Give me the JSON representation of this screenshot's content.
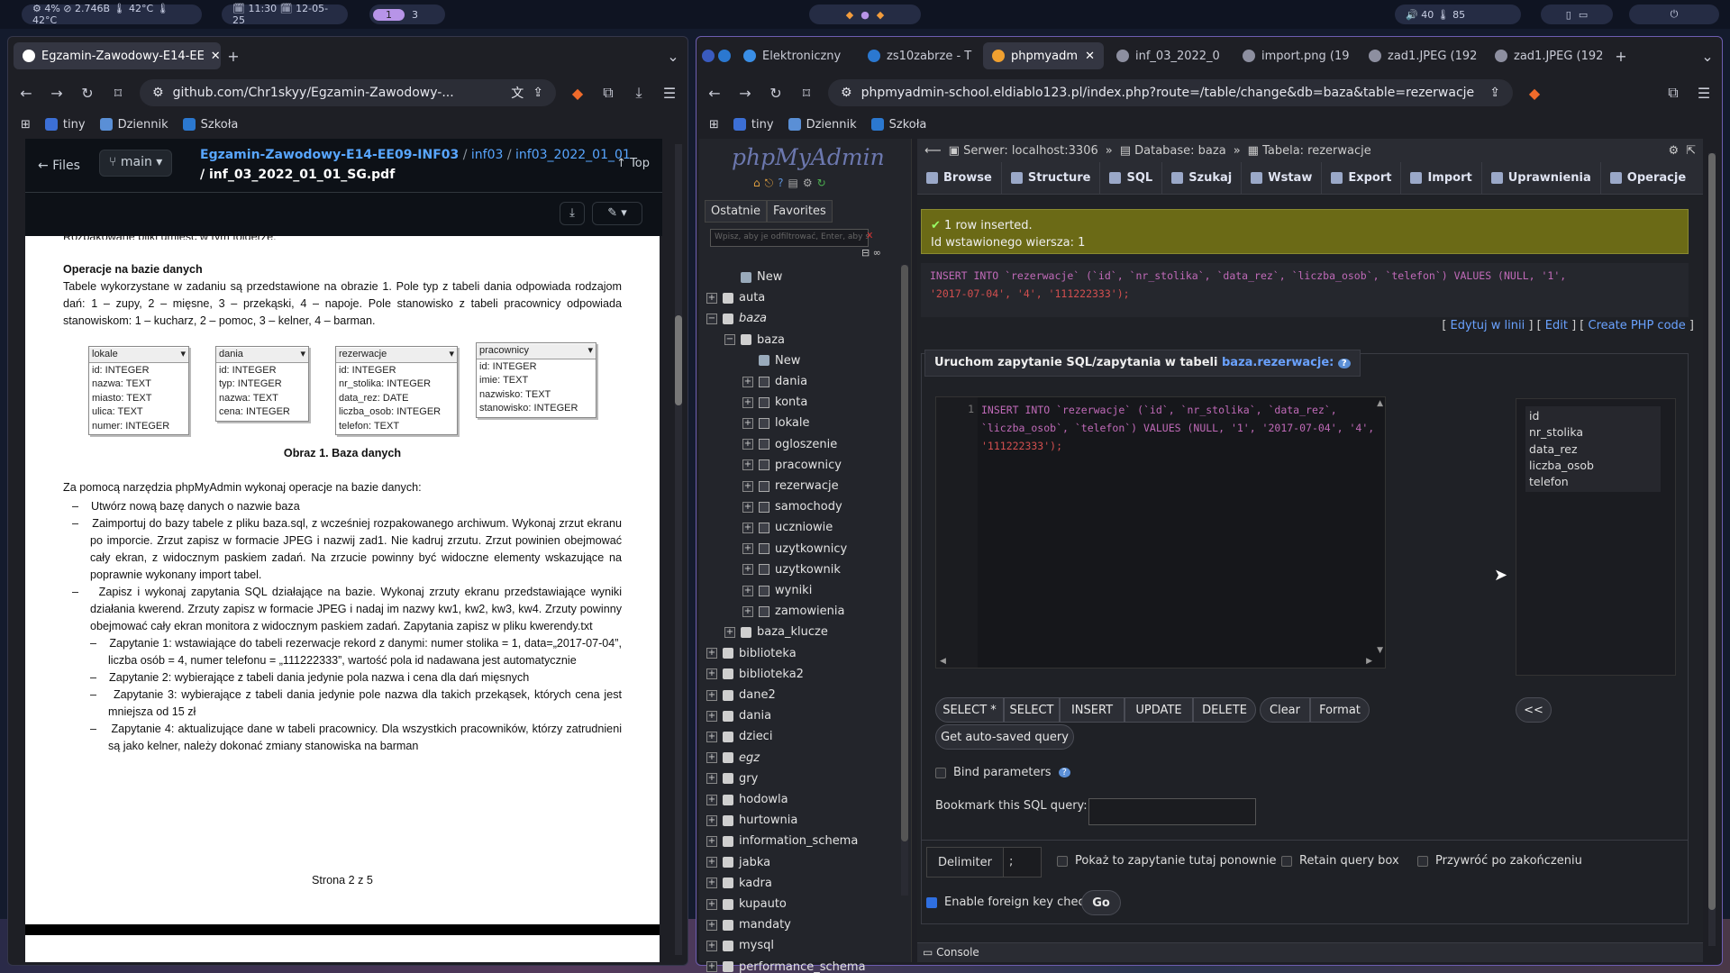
{
  "topbar": {
    "left_stats": "⚙ 4%  ⊘ 2.746B  🌡 42°C  🌡 42°C",
    "clock": "🗓 11:30 🗓 12-05-25",
    "workspaces": [
      "1",
      "3"
    ],
    "right_stats": "🔊 40  🌡 85"
  },
  "left_browser": {
    "tab_title": "Egzamin-Zawodowy-E14-EE",
    "url": "github.com/Chr1skyy/Egzamin-Zawodowy-...",
    "bookmarks": [
      "tiny",
      "Dziennik",
      "Szkoła"
    ],
    "files_label": "Files",
    "branch": "main",
    "repo": "Egzamin-Zawodowy-E14-EE09-INF03",
    "path1": "inf03",
    "path2": "inf03_2022_01_01",
    "filename": "inf_03_2022_01_01_SG.pdf",
    "top_label": "Top"
  },
  "pdf": {
    "cut_line": "Rozpakowane pliki umieść w tym folderze.",
    "heading": "Operacje na bazie danych",
    "intro": "Tabele wykorzystane w zadaniu są przedstawione na obrazie 1. Pole typ z tabeli dania odpowiada rodzajom dań: 1 – zupy, 2 – mięsne, 3 – przekąski, 4 – napoje. Pole stanowisko z tabeli pracownicy odpowiada stanowiskom: 1 – kucharz, 2 – pomoc, 3 – kelner, 4 – barman.",
    "tables": [
      {
        "name": "lokale",
        "fields": [
          "id: INTEGER",
          "nazwa: TEXT",
          "miasto: TEXT",
          "ulica: TEXT",
          "numer: INTEGER"
        ]
      },
      {
        "name": "dania",
        "fields": [
          "id: INTEGER",
          "typ: INTEGER",
          "nazwa: TEXT",
          "cena: INTEGER"
        ]
      },
      {
        "name": "rezerwacje",
        "fields": [
          "id: INTEGER",
          "nr_stolika: INTEGER",
          "data_rez: DATE",
          "liczba_osob: INTEGER",
          "telefon: TEXT"
        ]
      },
      {
        "name": "pracownicy",
        "fields": [
          "id: INTEGER",
          "imie: TEXT",
          "nazwisko: TEXT",
          "stanowisko: INTEGER"
        ]
      }
    ],
    "caption": "Obraz 1. Baza danych",
    "ops_intro": "Za pomocą narzędzia phpMyAdmin wykonaj operacje na bazie danych:",
    "op1": "Utwórz nową bazę danych o nazwie baza",
    "op2": "Zaimportuj do bazy tabele z pliku baza.sql, z wcześniej rozpakowanego archiwum. Wykonaj zrzut ekranu po imporcie. Zrzut zapisz w formacie JPEG i nazwij zad1. Nie kadruj zrzutu. Zrzut powinien obejmować cały ekran, z widocznym paskiem zadań. Na zrzucie powinny być widoczne elementy wskazujące na poprawnie wykonany import tabel.",
    "op3": "Zapisz i wykonaj zapytania SQL działające na bazie. Wykonaj zrzuty ekranu przedstawiające wyniki działania kwerend. Zrzuty zapisz w formacie JPEG i nadaj im nazwy kw1, kw2, kw3, kw4. Zrzuty powinny obejmować cały ekran monitora z widocznym paskiem zadań. Zapytania zapisz w pliku kwerendy.txt",
    "q1": "Zapytanie 1: wstawiające do tabeli rezerwacje rekord z danymi: numer stolika = 1, data=„2017-07-04”, liczba osób = 4, numer telefonu = „111222333”, wartość pola id nadawana jest automatycznie",
    "q2": "Zapytanie 2: wybierające z tabeli dania jedynie pola nazwa i cena dla dań mięsnych",
    "q3": "Zapytanie 3: wybierające z tabeli dania jedynie pole nazwa dla takich przekąsek, których cena jest mniejsza od 15 zł",
    "q4": "Zapytanie 4: aktualizujące dane w tabeli pracownicy. Dla wszystkich pracowników, którzy zatrudnieni są jako kelner, należy dokonać zmiany stanowiska na barman",
    "footer": "Strona 2 z 5"
  },
  "right_browser": {
    "tabs": [
      "Elektroniczny",
      "zs10zabrze - T",
      "phpmyadm",
      "inf_03_2022_0",
      "import.png (19",
      "zad1.JPEG (192",
      "zad1.JPEG (192"
    ],
    "url": "phpmyadmin-school.eldiablo123.pl/index.php?route=/table/change&db=baza&table=rezerwacje",
    "bookmarks": [
      "tiny",
      "Dziennik",
      "Szkoła"
    ]
  },
  "pma": {
    "logo": "phpMyAdmin",
    "recent": "Ostatnie",
    "favorites": "Favorites",
    "filter_placeholder": "Wpisz, aby je odfiltrować, Enter, aby s",
    "tree": [
      {
        "label": "New",
        "level": 1,
        "kind": "new"
      },
      {
        "label": "auta",
        "level": 0,
        "kind": "db"
      },
      {
        "label": "baza",
        "level": 0,
        "kind": "db-open"
      },
      {
        "label": "baza",
        "level": 1,
        "kind": "db-open"
      },
      {
        "label": "New",
        "level": 2,
        "kind": "new"
      },
      {
        "label": "dania",
        "level": 2,
        "kind": "tbl"
      },
      {
        "label": "konta",
        "level": 2,
        "kind": "tbl"
      },
      {
        "label": "lokale",
        "level": 2,
        "kind": "tbl"
      },
      {
        "label": "ogloszenie",
        "level": 2,
        "kind": "tbl"
      },
      {
        "label": "pracownicy",
        "level": 2,
        "kind": "tbl"
      },
      {
        "label": "rezerwacje",
        "level": 2,
        "kind": "tbl"
      },
      {
        "label": "samochody",
        "level": 2,
        "kind": "tbl"
      },
      {
        "label": "uczniowie",
        "level": 2,
        "kind": "tbl"
      },
      {
        "label": "uzytkownicy",
        "level": 2,
        "kind": "tbl"
      },
      {
        "label": "uzytkownik",
        "level": 2,
        "kind": "tbl"
      },
      {
        "label": "wyniki",
        "level": 2,
        "kind": "tbl"
      },
      {
        "label": "zamowienia",
        "level": 2,
        "kind": "tbl"
      },
      {
        "label": "baza_klucze",
        "level": 1,
        "kind": "db"
      },
      {
        "label": "biblioteka",
        "level": 0,
        "kind": "db"
      },
      {
        "label": "biblioteka2",
        "level": 0,
        "kind": "db"
      },
      {
        "label": "dane2",
        "level": 0,
        "kind": "db"
      },
      {
        "label": "dania",
        "level": 0,
        "kind": "db"
      },
      {
        "label": "dzieci",
        "level": 0,
        "kind": "db"
      },
      {
        "label": "egz",
        "level": 0,
        "kind": "db"
      },
      {
        "label": "gry",
        "level": 0,
        "kind": "db"
      },
      {
        "label": "hodowla",
        "level": 0,
        "kind": "db"
      },
      {
        "label": "hurtownia",
        "level": 0,
        "kind": "db"
      },
      {
        "label": "information_schema",
        "level": 0,
        "kind": "db"
      },
      {
        "label": "jabka",
        "level": 0,
        "kind": "db"
      },
      {
        "label": "kadra",
        "level": 0,
        "kind": "db"
      },
      {
        "label": "kupauto",
        "level": 0,
        "kind": "db"
      },
      {
        "label": "mandaty",
        "level": 0,
        "kind": "db"
      },
      {
        "label": "mysql",
        "level": 0,
        "kind": "db"
      },
      {
        "label": "performance_schema",
        "level": 0,
        "kind": "db"
      }
    ],
    "breadcrumb": {
      "server": "Serwer: localhost:3306",
      "database": "Database: baza",
      "table": "Tabela: rezerwacje"
    },
    "nav": [
      "Browse",
      "Structure",
      "SQL",
      "Szukaj",
      "Wstaw",
      "Export",
      "Import",
      "Uprawnienia",
      "Operacje"
    ],
    "success": "1 row inserted.",
    "inserted_id": "Id wstawionego wiersza: 1",
    "query_line1": "INSERT INTO `rezerwacje` (`id`, `nr_stolika`, `data_rez`, `liczba_osob`, `telefon`) VALUES (NULL, '1',",
    "query_line2": "'2017-07-04', '4', '111222333');",
    "links": [
      "Edytuj w linii",
      "Edit",
      "Create PHP code"
    ],
    "run_query_label": "Uruchom zapytanie SQL/zapytania w tabeli",
    "run_query_table": "baza.rezerwacje:",
    "editor_line_no": "1",
    "editor_l1": "INSERT INTO `rezerwacje` (`id`, `nr_stolika`, `data_rez`,",
    "editor_l2": "`liczba_osob`, `telefon`) VALUES (NULL, '1', '2017-07-04', '4',",
    "editor_l3": "'111222333');",
    "columns": [
      "id",
      "nr_stolika",
      "data_rez",
      "liczba_osob",
      "telefon"
    ],
    "buttons": [
      "SELECT *",
      "SELECT",
      "INSERT",
      "UPDATE",
      "DELETE",
      "Clear",
      "Format"
    ],
    "autosaved": "Get auto-saved query",
    "insert_col": "<<",
    "bind_params": "Bind parameters",
    "bookmark_label": "Bookmark this SQL query:",
    "delimiter_label": "Delimiter",
    "delimiter_value": ";",
    "show_again": "Pokaż to zapytanie tutaj ponownie",
    "retain": "Retain query box",
    "restore": "Przywróć po zakończeniu",
    "fk_checks": "Enable foreign key checks",
    "go": "Go",
    "console": "Console"
  }
}
